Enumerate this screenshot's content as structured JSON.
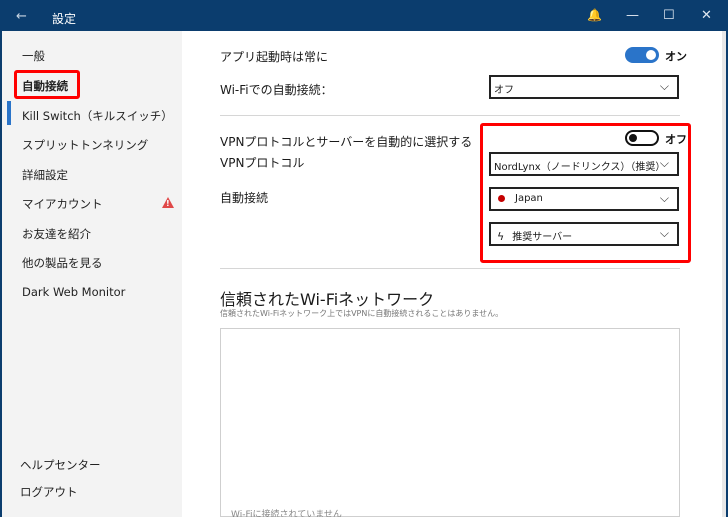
{
  "window": {
    "title": "設定",
    "back_icon": "←",
    "bell_icon": "🔔",
    "minimize": "—",
    "maximize": "☐",
    "close": "✕"
  },
  "sidebar": {
    "items": [
      {
        "label": "一般"
      },
      {
        "label": "自動接続"
      },
      {
        "label": "Kill Switch（キルスイッチ）"
      },
      {
        "label": "スプリットトンネリング"
      },
      {
        "label": "詳細設定"
      },
      {
        "label": "マイアカウント"
      },
      {
        "label": "お友達を紹介"
      },
      {
        "label": "他の製品を見る"
      },
      {
        "label": "Dark Web Monitor"
      }
    ],
    "bottom": [
      {
        "label": "ヘルプセンター"
      },
      {
        "label": "ログアウト"
      }
    ],
    "warning_glyph": "!"
  },
  "main": {
    "launch_label": "アプリ起動時は常に",
    "launch_toggle_text": "オン",
    "wifi_auto_label": "Wi-Fiでの自動接続：",
    "wifi_auto_value": "オフ",
    "auto_select_label": "VPNプロトコルとサーバーを自動的に選択する",
    "auto_select_toggle_text": "オフ",
    "protocol_label": "VPNプロトコル",
    "protocol_value": "NordLynx（ノードリンクス）（推奨）",
    "autoconnect_label": "自動接続",
    "country_value": "Japan",
    "server_value": "推奨サーバー",
    "trusted_title": "信頼されたWi-Fiネットワーク",
    "trusted_desc": "信頼されたWi-Fiネットワーク上ではVPNに自動接続されることはありません。",
    "trusted_empty": "Wi-Fiに接続されていません"
  },
  "colors": {
    "titlebar": "#0b3d6e",
    "accent": "#2a74c9",
    "highlight": "#ff0000",
    "warning": "#e04848"
  }
}
